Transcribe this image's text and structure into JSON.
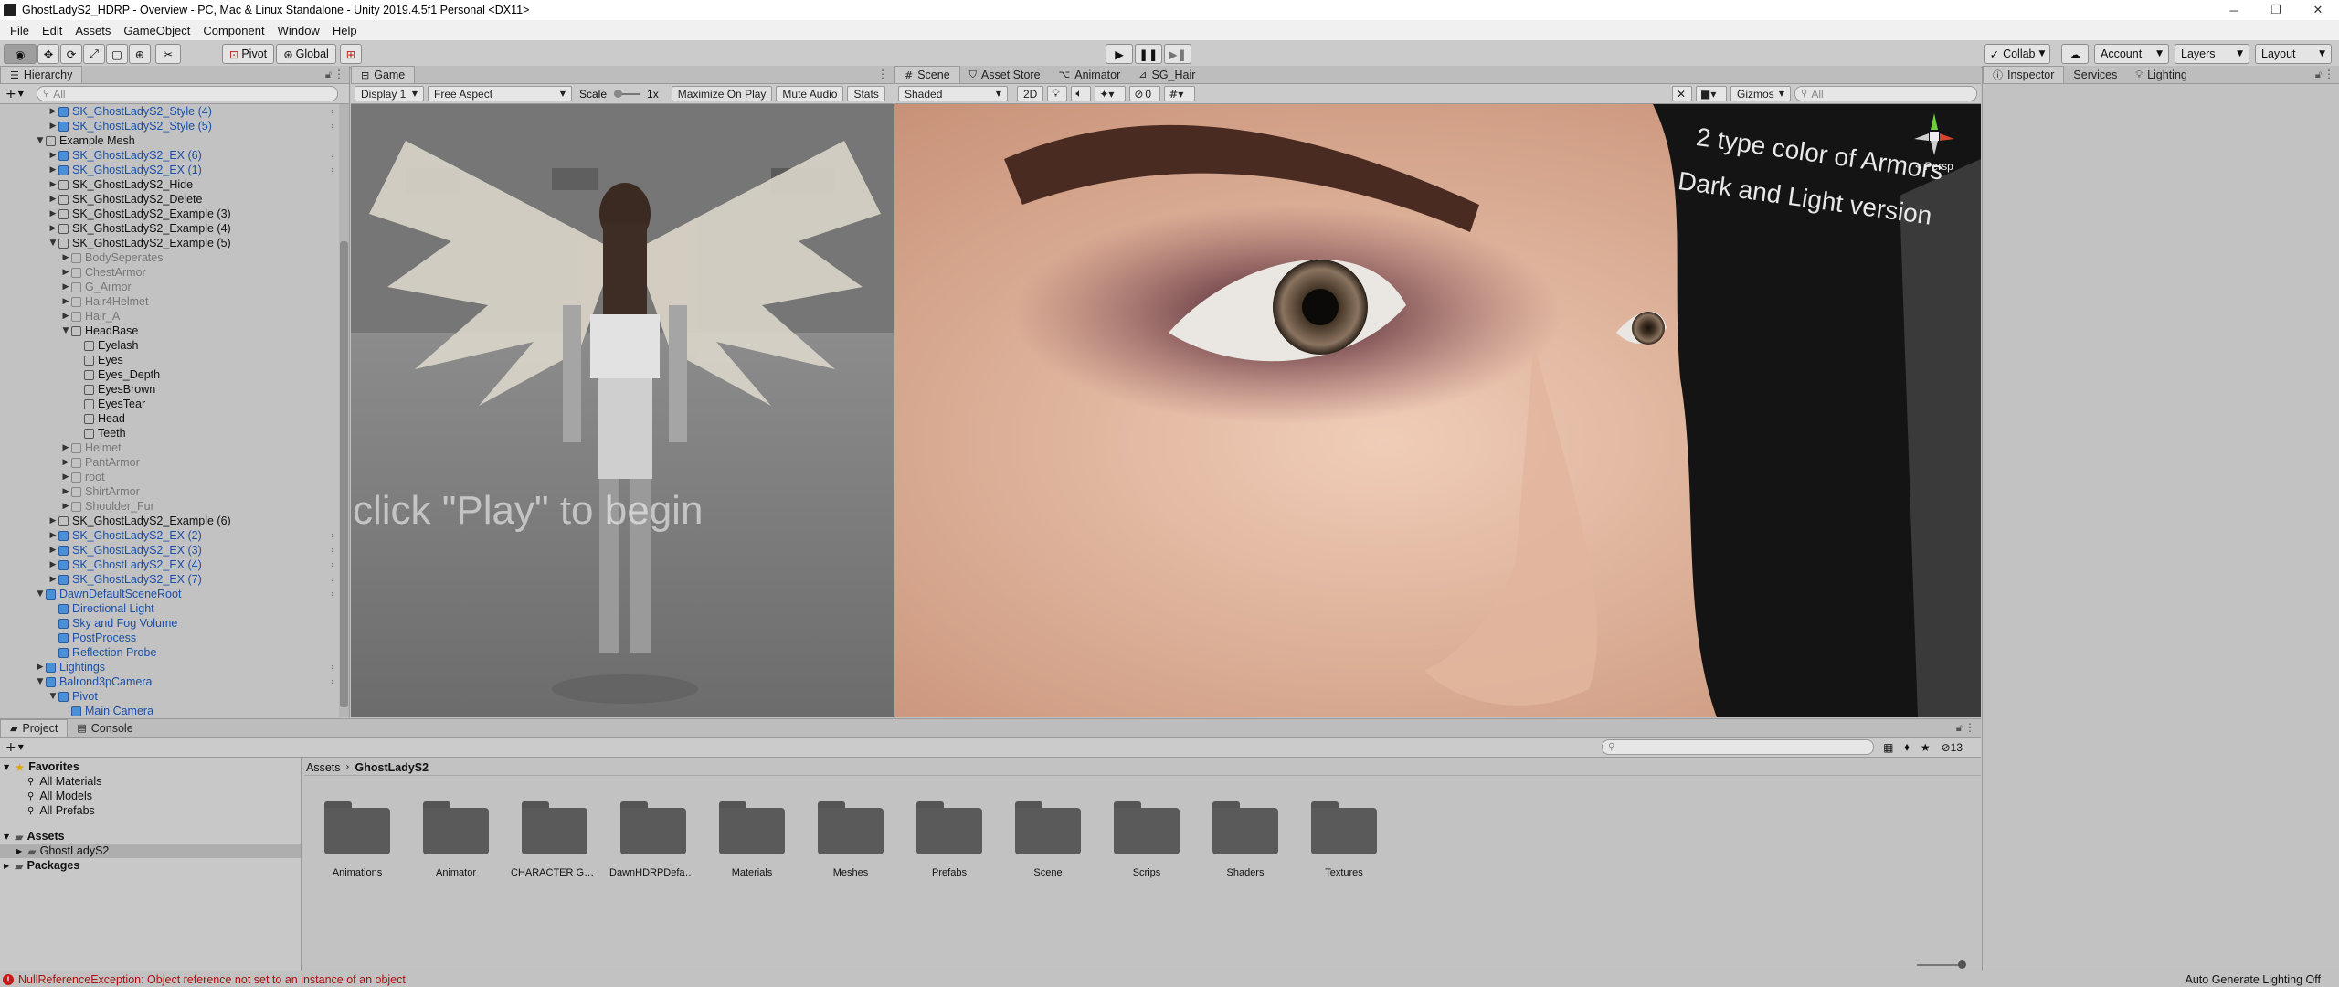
{
  "window": {
    "title": "GhostLadyS2_HDRP - Overview - PC, Mac & Linux Standalone - Unity 2019.4.5f1 Personal <DX11>",
    "controls": [
      "─",
      "❐",
      "✕"
    ]
  },
  "menu": [
    "File",
    "Edit",
    "Assets",
    "GameObject",
    "Component",
    "Window",
    "Help"
  ],
  "toolbar": {
    "pivot": "Pivot",
    "global": "Global",
    "collab": "Collab",
    "account": "Account",
    "layers": "Layers",
    "layout": "Layout"
  },
  "hierarchy": {
    "tab": "Hierarchy",
    "search_placeholder": "All",
    "rows": [
      {
        "label": "SK_GhostLadyS2_Style (4)",
        "indent": 1,
        "arrow": "▶",
        "kind": "prefab",
        "more": true
      },
      {
        "label": "SK_GhostLadyS2_Style (5)",
        "indent": 1,
        "arrow": "▶",
        "kind": "prefab",
        "more": true
      },
      {
        "label": "Example Mesh",
        "indent": 0,
        "arrow": "▼",
        "kind": "normal",
        "more": false
      },
      {
        "label": "SK_GhostLadyS2_EX (6)",
        "indent": 1,
        "arrow": "▶",
        "kind": "prefab",
        "more": true
      },
      {
        "label": "SK_GhostLadyS2_EX (1)",
        "indent": 1,
        "arrow": "▶",
        "kind": "prefab",
        "more": true
      },
      {
        "label": "SK_GhostLadyS2_Hide",
        "indent": 1,
        "arrow": "▶",
        "kind": "normal",
        "more": false
      },
      {
        "label": "SK_GhostLadyS2_Delete",
        "indent": 1,
        "arrow": "▶",
        "kind": "normal",
        "more": false
      },
      {
        "label": "SK_GhostLadyS2_Example (3)",
        "indent": 1,
        "arrow": "▶",
        "kind": "normal",
        "more": false
      },
      {
        "label": "SK_GhostLadyS2_Example (4)",
        "indent": 1,
        "arrow": "▶",
        "kind": "normal",
        "more": false
      },
      {
        "label": "SK_GhostLadyS2_Example (5)",
        "indent": 1,
        "arrow": "▼",
        "kind": "normal",
        "more": false
      },
      {
        "label": "BodySeperates",
        "indent": 2,
        "arrow": "▶",
        "kind": "dim",
        "more": false
      },
      {
        "label": "ChestArmor",
        "indent": 2,
        "arrow": "▶",
        "kind": "dim",
        "more": false
      },
      {
        "label": "G_Armor",
        "indent": 2,
        "arrow": "▶",
        "kind": "dim",
        "more": false
      },
      {
        "label": "Hair4Helmet",
        "indent": 2,
        "arrow": "▶",
        "kind": "dim",
        "more": false
      },
      {
        "label": "Hair_A",
        "indent": 2,
        "arrow": "▶",
        "kind": "dim",
        "more": false
      },
      {
        "label": "HeadBase",
        "indent": 2,
        "arrow": "▼",
        "kind": "normal",
        "more": false
      },
      {
        "label": "Eyelash",
        "indent": 3,
        "arrow": "",
        "kind": "normal",
        "more": false
      },
      {
        "label": "Eyes",
        "indent": 3,
        "arrow": "",
        "kind": "normal",
        "more": false
      },
      {
        "label": "Eyes_Depth",
        "indent": 3,
        "arrow": "",
        "kind": "normal",
        "more": false
      },
      {
        "label": "EyesBrown",
        "indent": 3,
        "arrow": "",
        "kind": "normal",
        "more": false
      },
      {
        "label": "EyesTear",
        "indent": 3,
        "arrow": "",
        "kind": "normal",
        "more": false
      },
      {
        "label": "Head",
        "indent": 3,
        "arrow": "",
        "kind": "normal",
        "more": false
      },
      {
        "label": "Teeth",
        "indent": 3,
        "arrow": "",
        "kind": "normal",
        "more": false
      },
      {
        "label": "Helmet",
        "indent": 2,
        "arrow": "▶",
        "kind": "dim",
        "more": false
      },
      {
        "label": "PantArmor",
        "indent": 2,
        "arrow": "▶",
        "kind": "dim",
        "more": false
      },
      {
        "label": "root",
        "indent": 2,
        "arrow": "▶",
        "kind": "dim",
        "more": false
      },
      {
        "label": "ShirtArmor",
        "indent": 2,
        "arrow": "▶",
        "kind": "dim",
        "more": false
      },
      {
        "label": "Shoulder_Fur",
        "indent": 2,
        "arrow": "▶",
        "kind": "dim",
        "more": false
      },
      {
        "label": "SK_GhostLadyS2_Example (6)",
        "indent": 1,
        "arrow": "▶",
        "kind": "normal",
        "more": false
      },
      {
        "label": "SK_GhostLadyS2_EX (2)",
        "indent": 1,
        "arrow": "▶",
        "kind": "prefab",
        "more": true
      },
      {
        "label": "SK_GhostLadyS2_EX (3)",
        "indent": 1,
        "arrow": "▶",
        "kind": "prefab",
        "more": true
      },
      {
        "label": "SK_GhostLadyS2_EX (4)",
        "indent": 1,
        "arrow": "▶",
        "kind": "prefab",
        "more": true
      },
      {
        "label": "SK_GhostLadyS2_EX (7)",
        "indent": 1,
        "arrow": "▶",
        "kind": "prefab",
        "more": true
      },
      {
        "label": "DawnDefaultSceneRoot",
        "indent": 0,
        "arrow": "▼",
        "kind": "prefab",
        "more": true
      },
      {
        "label": "Directional Light",
        "indent": 1,
        "arrow": "",
        "kind": "prefab",
        "more": false
      },
      {
        "label": "Sky and Fog Volume",
        "indent": 1,
        "arrow": "",
        "kind": "prefab",
        "more": false
      },
      {
        "label": "PostProcess",
        "indent": 1,
        "arrow": "",
        "kind": "prefab",
        "more": false
      },
      {
        "label": "Reflection Probe",
        "indent": 1,
        "arrow": "",
        "kind": "prefab",
        "more": false
      },
      {
        "label": "Lightings",
        "indent": 0,
        "arrow": "▶",
        "kind": "prefab",
        "more": true
      },
      {
        "label": "Balrond3pCamera",
        "indent": 0,
        "arrow": "▼",
        "kind": "prefab",
        "more": true
      },
      {
        "label": "Pivot",
        "indent": 1,
        "arrow": "▼",
        "kind": "prefab",
        "more": false
      },
      {
        "label": "Main Camera",
        "indent": 2,
        "arrow": "",
        "kind": "prefab",
        "more": false
      }
    ]
  },
  "game": {
    "tab": "Game",
    "display": "Display 1",
    "aspect": "Free Aspect",
    "scale_label": "Scale",
    "scale_value": "1x",
    "maximize": "Maximize On Play",
    "mute": "Mute Audio",
    "stats": "Stats",
    "overlay_text": "click \"Play\" to begin"
  },
  "scene": {
    "tabs": [
      "Scene",
      "Asset Store",
      "Animator",
      "SG_Hair"
    ],
    "shading": "Shaded",
    "mode_2d": "2D",
    "hidden_count": "0",
    "gizmos": "Gizmos",
    "search_placeholder": "All",
    "persp": "< Persp",
    "overlay_line1": "2 type color of Armors",
    "overlay_line2": "Dark and Light version"
  },
  "inspector": {
    "tabs": [
      "Inspector",
      "Services",
      "Lighting"
    ]
  },
  "project": {
    "tabs": [
      "Project",
      "Console"
    ],
    "favorites_label": "Favorites",
    "favorites": [
      "All Materials",
      "All Models",
      "All Prefabs"
    ],
    "assets_label": "Assets",
    "assets_children": [
      "GhostLadyS2"
    ],
    "packages_label": "Packages",
    "breadcrumb": [
      "Assets",
      "GhostLadyS2"
    ],
    "count": "13",
    "folders": [
      "Animations",
      "Animator",
      "CHARACTER GUI...",
      "DawnHDRPDefaul...",
      "Materials",
      "Meshes",
      "Prefabs",
      "Scene",
      "Scrips",
      "Shaders",
      "Textures"
    ]
  },
  "status": {
    "error": "NullReferenceException: Object reference not set to an instance of an object",
    "right": "Auto Generate Lighting Off"
  }
}
